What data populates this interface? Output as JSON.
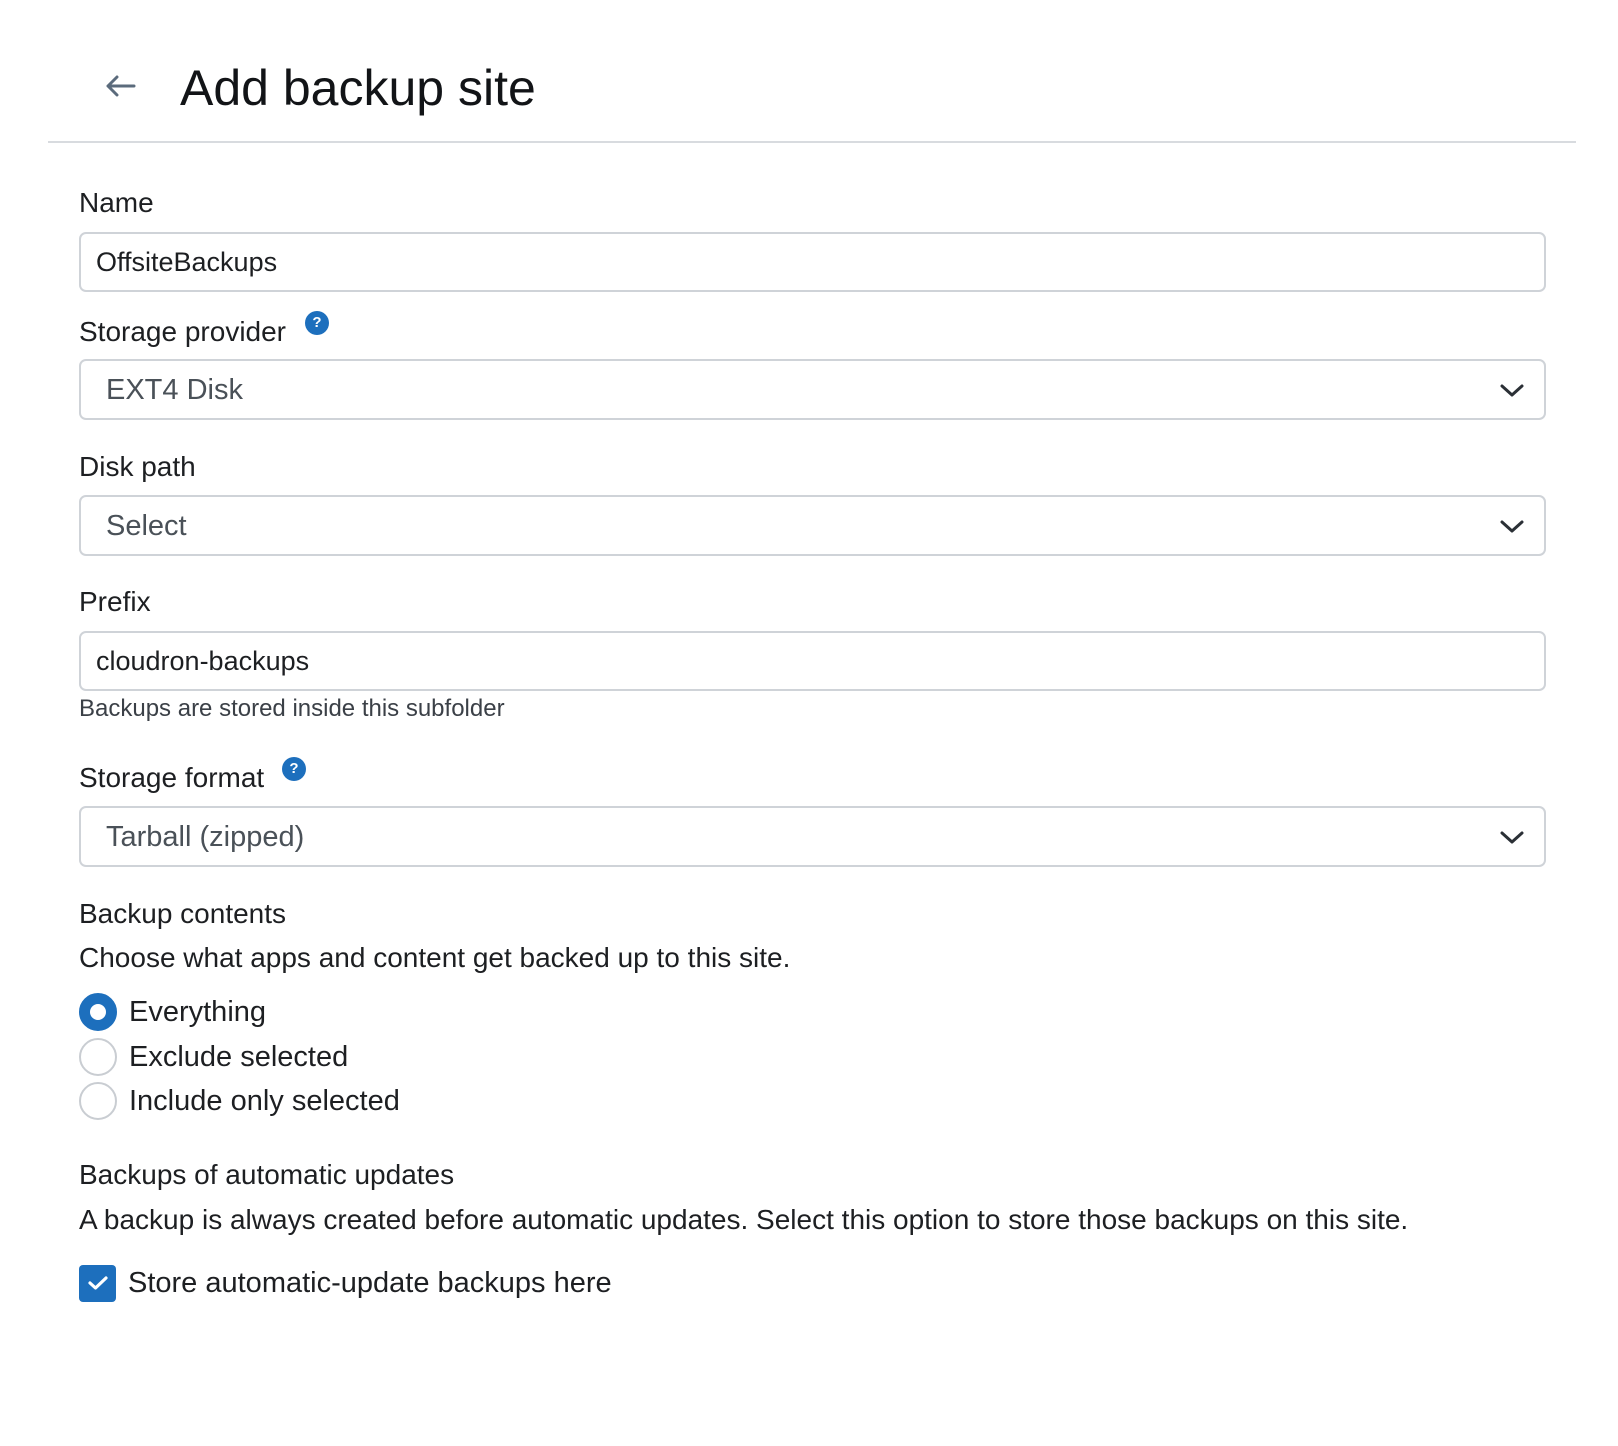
{
  "header": {
    "title": "Add backup site"
  },
  "form": {
    "name": {
      "label": "Name",
      "value": "OffsiteBackups"
    },
    "storage_provider": {
      "label": "Storage provider",
      "help": "?",
      "value": "EXT4 Disk"
    },
    "disk_path": {
      "label": "Disk path",
      "value": "Select"
    },
    "prefix": {
      "label": "Prefix",
      "value": "cloudron-backups",
      "hint": "Backups are stored inside this subfolder"
    },
    "storage_format": {
      "label": "Storage format",
      "help": "?",
      "value": "Tarball (zipped)"
    },
    "backup_contents": {
      "title": "Backup contents",
      "description": "Choose what apps and content get backed up to this site.",
      "options": [
        {
          "label": "Everything",
          "selected": true
        },
        {
          "label": "Exclude selected",
          "selected": false
        },
        {
          "label": "Include only selected",
          "selected": false
        }
      ]
    },
    "auto_updates": {
      "title": "Backups of automatic updates",
      "description": "A backup is always created before automatic updates. Select this option to store those backups on this site.",
      "checkbox_label": "Store automatic-update backups here",
      "checked": true
    }
  },
  "colors": {
    "accent": "#1d6fbd",
    "border": "#cfd3d8",
    "text": "#1d1f22"
  },
  "icons": {
    "back": "arrow-left-icon",
    "help": "question-circle-icon",
    "chevron": "chevron-down-icon",
    "check": "check-icon"
  }
}
